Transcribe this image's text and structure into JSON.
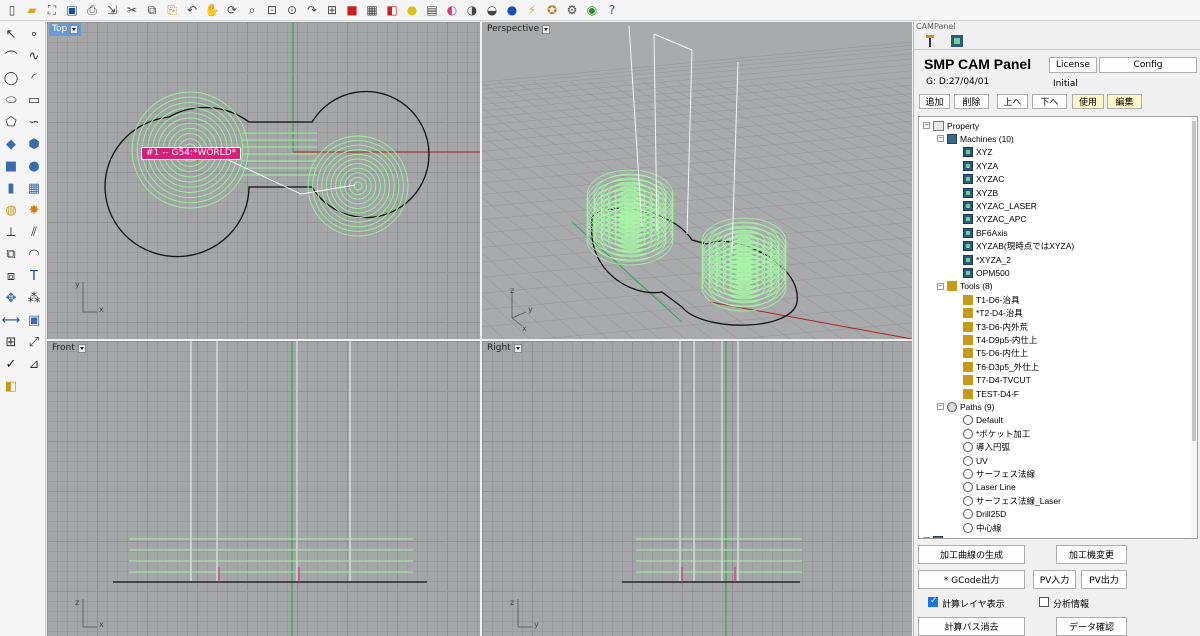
{
  "toolbar_top": {
    "icons": [
      "new-file-icon",
      "open-folder-icon",
      "zoom-extents-icon",
      "save-icon",
      "print-icon",
      "import-icon",
      "cut-icon",
      "copy-icon",
      "paste-icon",
      "undo-icon",
      "pan-icon",
      "rotate-view-icon",
      "zoom-icon",
      "zoom-window-icon",
      "zoom-selected-icon",
      "redo-view-icon",
      "four-views-icon",
      "car-icon",
      "grid-icon",
      "layer-icon",
      "light-icon",
      "properties-icon",
      "color-wheel-icon",
      "sphere-render-icon",
      "shaded-sphere-icon",
      "blue-sphere-icon",
      "lightning-icon",
      "gear-icon",
      "settings-icon",
      "render-ball-icon",
      "help-icon"
    ]
  },
  "toolbar_left": {
    "icons": [
      "select-arrow-icon",
      "point-icon",
      "polyline-icon",
      "curve-icon",
      "circle-icon",
      "arc-icon",
      "ellipse-icon",
      "rectangle-icon",
      "polygon-icon",
      "free-curve-icon",
      "surface-icon",
      "extrude-icon",
      "box-icon",
      "sphere-icon",
      "cylinder-icon",
      "mesh-icon",
      "boolean-icon",
      "explode-icon",
      "trim-icon",
      "split-icon",
      "join-icon",
      "fillet-icon",
      "offset-icon",
      "text-icon",
      "move-icon",
      "array-icon",
      "dimension-icon",
      "block-icon",
      "group-icon",
      "transform-icon",
      "check-icon",
      "analyze-icon",
      "layer-edit-icon"
    ]
  },
  "viewports": {
    "top": {
      "label": "Top",
      "axis_y": "y",
      "axis_x": "x",
      "tag": "#1 -- G54:*WORLD*"
    },
    "perspective": {
      "label": "Perspective",
      "axis_z": "z",
      "axis_y": "y",
      "axis_x": "x"
    },
    "front": {
      "label": "Front",
      "axis_z": "z",
      "axis_x": "x"
    },
    "right": {
      "label": "Right",
      "axis_z": "z",
      "axis_y": "y"
    }
  },
  "cam_panel": {
    "caption": "CAMPanel",
    "title": "SMP CAM Panel",
    "date": "G: D:27/04/01",
    "license_button": "License",
    "config_button": "Config",
    "initial_label": "Initial",
    "actions": {
      "add": "追加",
      "delete": "削除",
      "up": "上へ",
      "down": "下へ",
      "use": "使用",
      "edit": "編集"
    },
    "tree": {
      "property": "Property",
      "machines_label": "Machines (10)",
      "machines": [
        "XYZ",
        "XYZA",
        "XYZAC",
        "XYZB",
        "XYZAC_LASER",
        "XYZAC_APC",
        "BF6Axis",
        "XYZAB(現時点ではXYZA)",
        "*XYZA_2",
        "OPM500"
      ],
      "tools_label": "Tools (8)",
      "tools": [
        "T1-D6-治具",
        "*T2-D4-治具",
        "T3-D6-内外荒",
        "T4-D9p5-内仕上",
        "T5-D6-内仕上",
        "T6-D3p5_外仕上",
        "T7-D4-TVCUT",
        "TEST-D4-F"
      ],
      "paths_label": "Paths (9)",
      "paths": [
        "Default",
        "*ポケット加工",
        "導入円弧",
        "UV",
        "サーフェス法線",
        "Laser Line",
        "サーフェス法線_Laser",
        "Drill25D",
        "中心線"
      ],
      "cam_output": "CAM Output"
    },
    "bottom": {
      "generate_curve": "加工曲線の生成",
      "change_machine": "加工機変更",
      "gcode_output": "* GCode出力",
      "pv_input": "PV入力",
      "pv_output": "PV出力",
      "calc_layer_display": "計算レイヤ表示",
      "calc_layer_checked": true,
      "analysis_info": "分析情報",
      "analysis_checked": false,
      "clear_calc_path": "計算パス消去",
      "data_check": "データ確認"
    }
  }
}
